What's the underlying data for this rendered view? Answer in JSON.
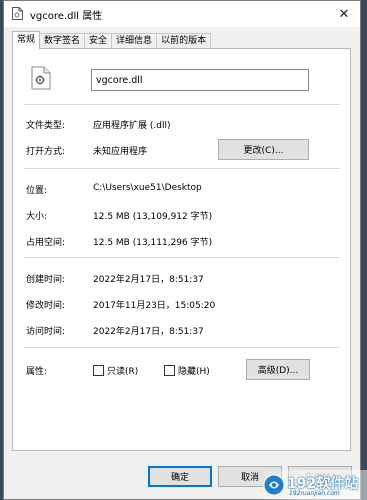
{
  "window": {
    "title": "vgcore.dll 属性",
    "close_glyph": "✕"
  },
  "tabs": [
    {
      "label": "常规",
      "active": true
    },
    {
      "label": "数字签名",
      "active": false
    },
    {
      "label": "安全",
      "active": false
    },
    {
      "label": "详细信息",
      "active": false
    },
    {
      "label": "以前的版本",
      "active": false
    }
  ],
  "general": {
    "file_name": "vgcore.dll",
    "file_type_label": "文件类型:",
    "file_type_value": "应用程序扩展 (.dll)",
    "opens_with_label": "打开方式:",
    "opens_with_value": "未知应用程序",
    "change_button": "更改(C)...",
    "location_label": "位置:",
    "location_value": "C:\\Users\\xue51\\Desktop",
    "size_label": "大小:",
    "size_value": "12.5 MB (13,109,912 字节)",
    "size_on_disk_label": "占用空间:",
    "size_on_disk_value": "12.5 MB (13,111,296 字节)",
    "created_label": "创建时间:",
    "created_value": "2022年2月17日，8:51:37",
    "modified_label": "修改时间:",
    "modified_value": "2017年11月23日，15:05:20",
    "accessed_label": "访问时间:",
    "accessed_value": "2022年2月17日，8:51:37",
    "attributes_label": "属性:",
    "readonly_label": "只读(R)",
    "readonly_checked": false,
    "hidden_label": "隐藏(H)",
    "hidden_checked": false,
    "advanced_button": "高级(D)..."
  },
  "footer": {
    "ok_button": "确定",
    "cancel_button": "取消",
    "apply_button": "应用(A)"
  },
  "watermark": {
    "brand": "192软件站",
    "url": "192ruanjian.com",
    "brand_color": "#0066aa"
  },
  "icons": {
    "title": "dll-file-icon",
    "file": "dll-file-gear-icon",
    "close": "close-icon"
  }
}
